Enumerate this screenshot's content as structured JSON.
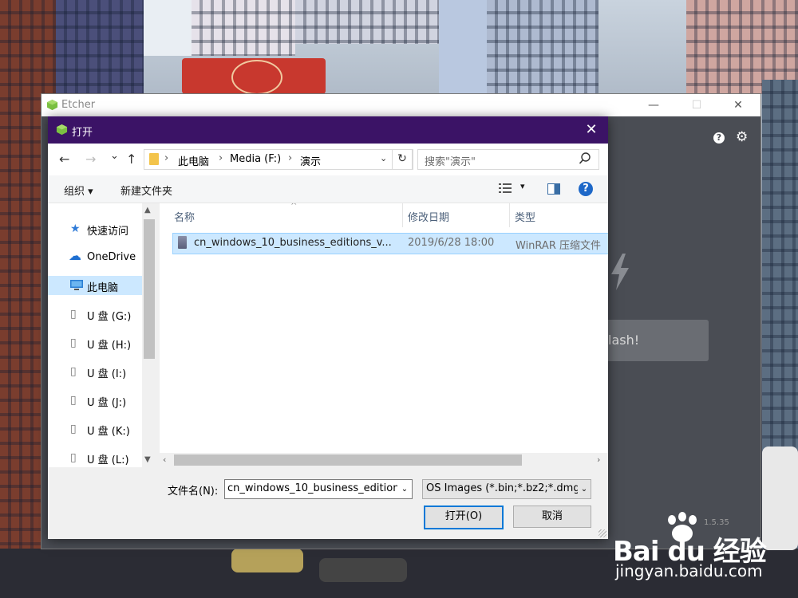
{
  "etcher": {
    "title": "Etcher",
    "help_glyph": "?",
    "settings_glyph": "⚙",
    "flash_label": "lash!",
    "version": "1.5.35",
    "window_controls": {
      "minimize": "—",
      "maximize": "☐",
      "close": "✕"
    }
  },
  "dialog": {
    "title": "打开",
    "close_glyph": "✕",
    "nav": {
      "back": "←",
      "forward": "→",
      "recent": "⌄",
      "up": "↑"
    },
    "address": {
      "crumbs": [
        "此电脑",
        "Media (F:)",
        "演示"
      ],
      "separator": "›",
      "dropdown": "⌄",
      "refresh": "↻"
    },
    "search": {
      "placeholder": "搜索\"演示\"",
      "icon": "search-icon"
    },
    "toolbar": {
      "organize": "组织 ▾",
      "new_folder": "新建文件夹",
      "view_dropdown": "▾",
      "help": "?"
    },
    "sidebar": {
      "items": [
        {
          "label": "快速访问",
          "icon": "★",
          "icon_color": "#2f7bd8"
        },
        {
          "label": "OneDrive",
          "icon": "☁",
          "icon_color": "#1e6fd1"
        },
        {
          "label": "此电脑",
          "icon": "🖥",
          "icon_color": "#2a7fd4",
          "selected": true
        },
        {
          "label": "U 盘 (G:)",
          "icon": "▯",
          "icon_color": "#777777"
        },
        {
          "label": "U 盘 (H:)",
          "icon": "▯",
          "icon_color": "#777777"
        },
        {
          "label": "U 盘 (I:)",
          "icon": "▯",
          "icon_color": "#777777"
        },
        {
          "label": "U 盘 (J:)",
          "icon": "▯",
          "icon_color": "#777777"
        },
        {
          "label": "U 盘 (K:)",
          "icon": "▯",
          "icon_color": "#777777"
        },
        {
          "label": "U 盘 (L:)",
          "icon": "▯",
          "icon_color": "#777777"
        }
      ],
      "scroll_up": "▲",
      "scroll_down": "▼"
    },
    "columns": {
      "name": "名称",
      "modified": "修改日期",
      "type": "类型"
    },
    "sort_caret": "^",
    "files": [
      {
        "name": "cn_windows_10_business_editions_v...",
        "modified": "2019/6/28 18:00",
        "type": "WinRAR 压缩文件"
      }
    ],
    "hscroll": {
      "left": "‹",
      "right": "›"
    },
    "filename": {
      "label": "文件名(N):",
      "value": "cn_windows_10_business_edition",
      "dropdown": "⌄"
    },
    "filter": {
      "value": "OS Images (*.bin;*.bz2;*.dmg",
      "dropdown": "⌄"
    },
    "buttons": {
      "open": "打开(O)",
      "cancel": "取消"
    }
  },
  "watermark": {
    "brand": "Bai du 经验",
    "url": "jingyan.baidu.com"
  },
  "colors": {
    "dialog_titlebar": "#3b1366",
    "selection": "#cce8ff",
    "accent_blue": "#0078d7",
    "etcher_bg": "#4a4d54"
  }
}
